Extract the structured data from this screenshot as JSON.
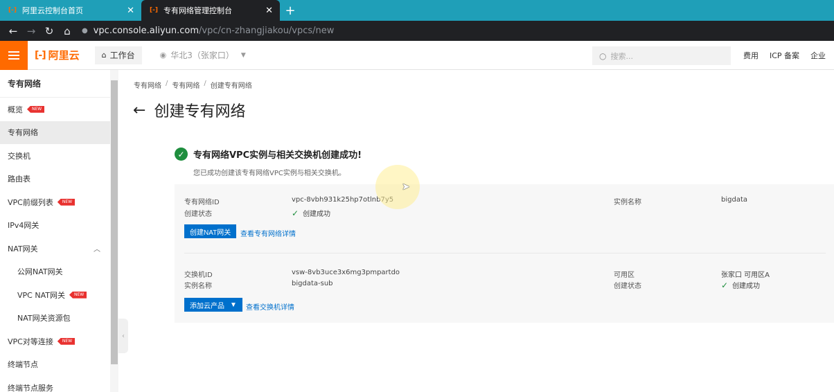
{
  "browser": {
    "tabs": [
      {
        "label": "阿里云控制台首页",
        "close": "✕",
        "active": false
      },
      {
        "label": "专有网络管理控制台",
        "close": "✕",
        "active": true
      }
    ],
    "new_tab": "+",
    "url_host": "vpc.console.aliyun.com",
    "url_path": "/vpc/cn-zhangjiakou/vpcs/new"
  },
  "topnav": {
    "logo_text": "阿里云",
    "workbench": "工作台",
    "region": "华北3（张家口）",
    "search_placeholder": "搜索...",
    "links": [
      "费用",
      "ICP 备案",
      "企业"
    ]
  },
  "sidebar": {
    "title": "专有网络",
    "items": [
      {
        "label": "概览",
        "badge": "NEW"
      },
      {
        "label": "专有网络"
      },
      {
        "label": "交换机"
      },
      {
        "label": "路由表"
      },
      {
        "label": "VPC前缀列表",
        "badge": "NEW"
      },
      {
        "label": "IPv4网关"
      },
      {
        "label": "NAT网关"
      },
      {
        "label": "公网NAT网关"
      },
      {
        "label": "VPC NAT网关",
        "badge": "NEW"
      },
      {
        "label": "NAT网关资源包"
      },
      {
        "label": "VPC对等连接",
        "badge": "NEW"
      },
      {
        "label": "终端节点"
      },
      {
        "label": "终端节点服务"
      }
    ]
  },
  "breadcrumb": [
    "专有网络",
    "专有网络",
    "创建专有网络"
  ],
  "breadcrumb_sep": "/",
  "page_title": "创建专有网络",
  "result": {
    "title": "专有网络VPC实例与相关交换机创建成功!",
    "subtitle": "您已成功创建该专有网络VPC实例与相关交换机。",
    "vpc": {
      "id_label": "专有网络ID",
      "id_value": "vpc-8vbh931k25hp7otlnb7y5",
      "status_label": "创建状态",
      "status_value": "创建成功",
      "name_label": "实例名称",
      "name_value": "bigdata",
      "create_nat_button": "创建NAT网关",
      "detail_link": "查看专有网络详情"
    },
    "vswitch": {
      "id_label": "交换机ID",
      "id_value": "vsw-8vb3uce3x6mg3pmpartdo",
      "name_label": "实例名称",
      "name_value": "bigdata-sub",
      "zone_label": "可用区",
      "zone_value": "张家口 可用区A",
      "status_label": "创建状态",
      "status_value": "创建成功",
      "add_product_button": "添加云产品",
      "detail_link": "查看交换机详情"
    }
  },
  "colors": {
    "brand": "#ff6a00",
    "primary": "#0070cc",
    "success": "#1e8e3e",
    "badge": "#e8312f"
  }
}
